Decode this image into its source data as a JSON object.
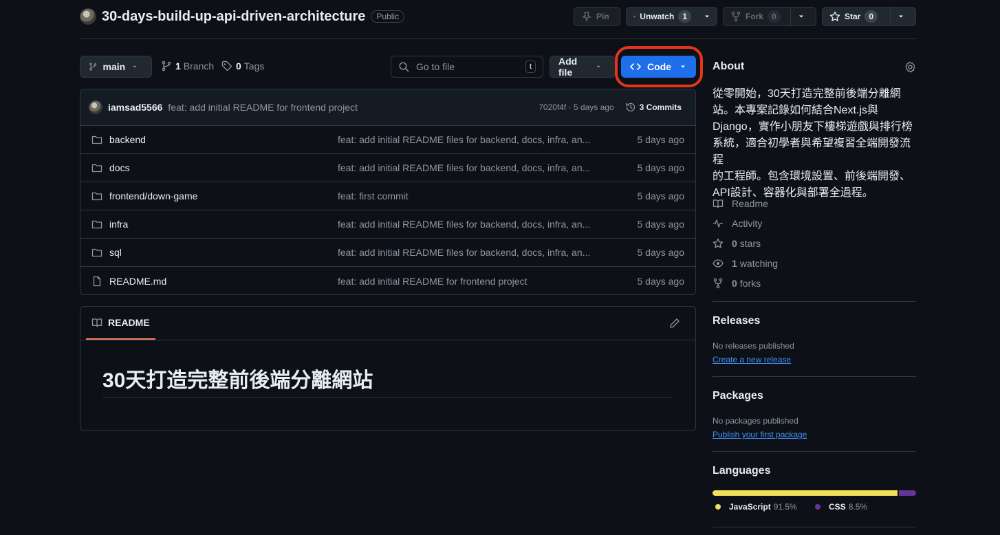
{
  "repo": {
    "name": "30-days-build-up-api-driven-architecture",
    "visibility": "Public"
  },
  "header_actions": {
    "pin_label": "Pin",
    "unwatch_label": "Unwatch",
    "watch_count": "1",
    "fork_label": "Fork",
    "fork_count": "0",
    "star_label": "Star",
    "star_count": "0"
  },
  "toolbar": {
    "branch": "main",
    "branch_count": "1",
    "branch_label": "Branch",
    "tag_count": "0",
    "tag_label": "Tags",
    "goto_placeholder": "Go to file",
    "goto_shortcut": "t",
    "add_file_label": "Add file",
    "code_label": "Code"
  },
  "latest_commit": {
    "author": "iamsad5566",
    "message": "feat: add initial README for frontend project",
    "meta": "7020f4f · 5 days ago",
    "commits_count": "3 Commits"
  },
  "files": [
    {
      "name": "backend",
      "type": "folder",
      "commit": "feat: add initial README files for backend, docs, infra, an...",
      "age": "5 days ago"
    },
    {
      "name": "docs",
      "type": "folder",
      "commit": "feat: add initial README files for backend, docs, infra, an...",
      "age": "5 days ago"
    },
    {
      "name": "frontend/down-game",
      "type": "folder",
      "commit": "feat: first commit",
      "age": "5 days ago"
    },
    {
      "name": "infra",
      "type": "folder",
      "commit": "feat: add initial README files for backend, docs, infra, an...",
      "age": "5 days ago"
    },
    {
      "name": "sql",
      "type": "folder",
      "commit": "feat: add initial README files for backend, docs, infra, an...",
      "age": "5 days ago"
    },
    {
      "name": "README.md",
      "type": "file",
      "commit": "feat: add initial README for frontend project",
      "age": "5 days ago"
    }
  ],
  "readme": {
    "tab_label": "README",
    "heading": "30天打造完整前後端分離網站"
  },
  "about": {
    "title": "About",
    "description_lines": [
      "從零開始，30天打造完整前後端分離網",
      "站。本專案記錄如何結合Next.js與",
      "Django，實作小朋友下樓梯遊戲與排行榜",
      "系統，適合初學者與希望複習全端開發流程",
      "的工程師。包含環境設置、前後端開發、",
      "API設計、容器化與部署全過程。"
    ],
    "readme_link": "Readme",
    "activity_link": "Activity",
    "stars_count": "0",
    "stars_label": "stars",
    "watching_count": "1",
    "watching_label": "watching",
    "forks_count": "0",
    "forks_label": "forks"
  },
  "releases": {
    "title": "Releases",
    "empty_text": "No releases published",
    "create_link": "Create a new release"
  },
  "packages": {
    "title": "Packages",
    "empty_text": "No packages published",
    "publish_link": "Publish your first package"
  },
  "languages": {
    "title": "Languages",
    "items": [
      {
        "name": "JavaScript",
        "percent": "91.5%",
        "color": "#f1e05a",
        "share": 91.5
      },
      {
        "name": "CSS",
        "percent": "8.5%",
        "color": "#663399",
        "share": 8.5
      }
    ]
  },
  "colors": {
    "accent": "#1f6feb",
    "highlight_ring": "#e5341c",
    "link": "#4493f8"
  }
}
